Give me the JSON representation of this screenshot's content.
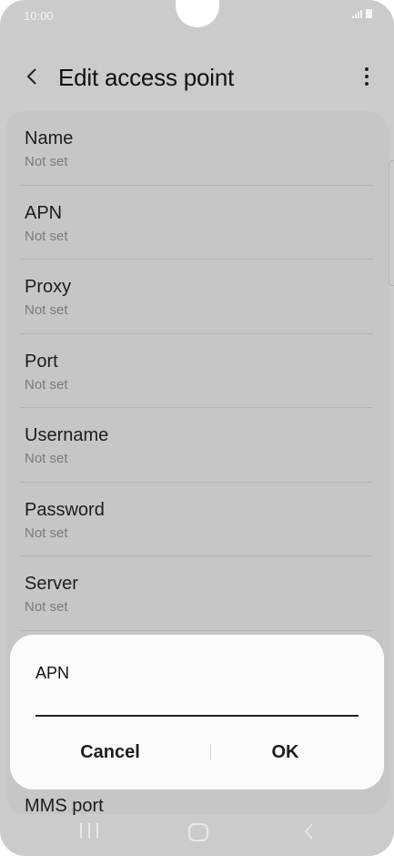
{
  "status_bar": {
    "time": "10:00"
  },
  "header": {
    "title": "Edit access point"
  },
  "settings": {
    "items": [
      {
        "label": "Name",
        "value": "Not set"
      },
      {
        "label": "APN",
        "value": "Not set"
      },
      {
        "label": "Proxy",
        "value": "Not set"
      },
      {
        "label": "Port",
        "value": "Not set"
      },
      {
        "label": "Username",
        "value": "Not set"
      },
      {
        "label": "Password",
        "value": "Not set"
      },
      {
        "label": "Server",
        "value": "Not set"
      }
    ],
    "partial_item_label": "MMS port"
  },
  "dialog": {
    "title": "APN",
    "input_value": "",
    "cancel_label": "Cancel",
    "ok_label": "OK"
  },
  "icons": {
    "back": "chevron-left-icon",
    "more": "more-vertical-icon",
    "signal": "signal-icon",
    "battery": "battery-icon",
    "nav_recents": "recents-icon",
    "nav_home": "home-icon",
    "nav_back": "back-icon"
  },
  "colors": {
    "screen_dim": "#cbcbcb",
    "dialog_bg": "#fbfbfb",
    "text_primary": "#1d1d1d",
    "text_secondary": "#7a7a7a"
  }
}
